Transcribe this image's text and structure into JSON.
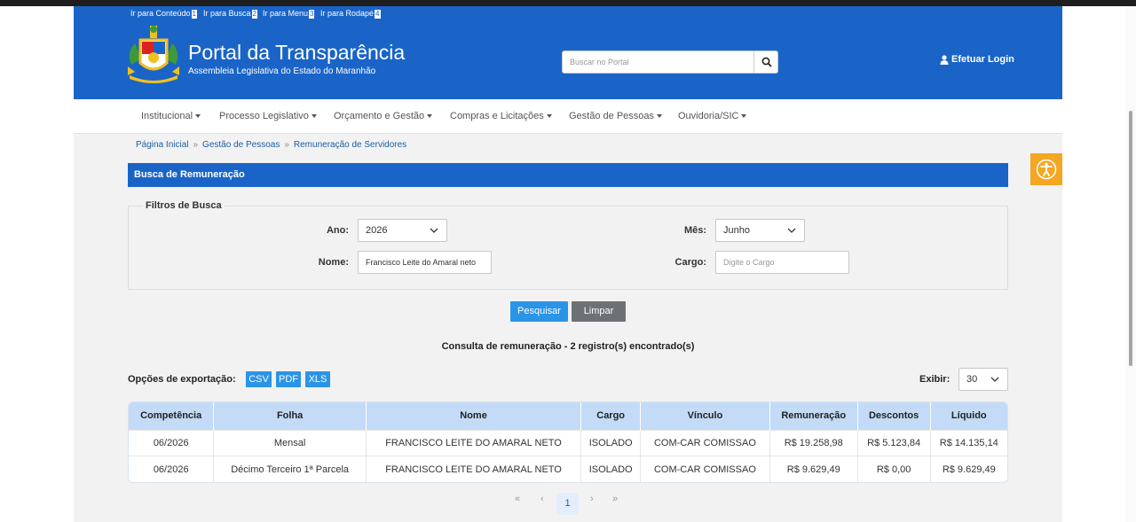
{
  "skip_links": [
    {
      "label": "Ir para Conteúdo",
      "key": "1"
    },
    {
      "label": "Ir para Busca",
      "key": "2"
    },
    {
      "label": "Ir para Menu",
      "key": "3"
    },
    {
      "label": "Ir para Rodapé",
      "key": "4"
    }
  ],
  "header": {
    "title": "Portal da Transparência",
    "subtitle": "Assembleia Legislativa do Estado do Maranhão",
    "search_placeholder": "Buscar no Portal",
    "login_label": "Efetuar Login",
    "logo_icon": "coat-of-arms-icon"
  },
  "nav": {
    "items": [
      "Institucional",
      "Processo Legislativo",
      "Orçamento e Gestão",
      "Compras e Licitações",
      "Gestão de Pessoas",
      "Ouvidoria/SIC"
    ]
  },
  "breadcrumb": [
    "Página Inicial",
    "Gestão de Pessoas",
    "Remuneração de Servidores"
  ],
  "panel": {
    "title": "Busca de Remuneração",
    "filters_legend": "Filtros de Busca"
  },
  "filters": {
    "ano_label": "Ano:",
    "ano_value": "2026",
    "mes_label": "Mês:",
    "mes_value": "Junho",
    "nome_label": "Nome:",
    "nome_value": "Francisco Leite do Amaral neto",
    "cargo_label": "Cargo:",
    "cargo_placeholder": "Digite o Cargo"
  },
  "actions": {
    "search_label": "Pesquisar",
    "clear_label": "Limpar"
  },
  "results": {
    "count_text": "Consulta de remuneração - 2 registro(s) encontrado(s)",
    "export_label": "Opções de exportação:",
    "export_buttons": [
      "CSV",
      "PDF",
      "XLS"
    ],
    "show_label": "Exibir:",
    "show_value": "30"
  },
  "table": {
    "columns": [
      "Competência",
      "Folha",
      "Nome",
      "Cargo",
      "Vínculo",
      "Remuneração",
      "Descontos",
      "Líquido"
    ],
    "rows": [
      [
        "06/2026",
        "Mensal",
        "FRANCISCO LEITE DO AMARAL NETO",
        "ISOLADO",
        "COM-CAR COMISSAO",
        "R$ 19.258,98",
        "R$ 5.123,84",
        "R$ 14.135,14"
      ],
      [
        "06/2026",
        "Décimo Terceiro 1ª Parcela",
        "FRANCISCO LEITE DO AMARAL NETO",
        "ISOLADO",
        "COM-CAR COMISSAO",
        "R$ 9.629,49",
        "R$ 0,00",
        "R$ 9.629,49"
      ]
    ]
  },
  "pagination": {
    "first": "«",
    "prev": "‹",
    "current": "1",
    "next": "›",
    "last": "»"
  },
  "colors": {
    "brand_blue": "#1a64c8",
    "button_blue": "#2a94e6",
    "accessibility_orange": "#f5a623"
  },
  "accessibility_icon": "accessibility-icon"
}
